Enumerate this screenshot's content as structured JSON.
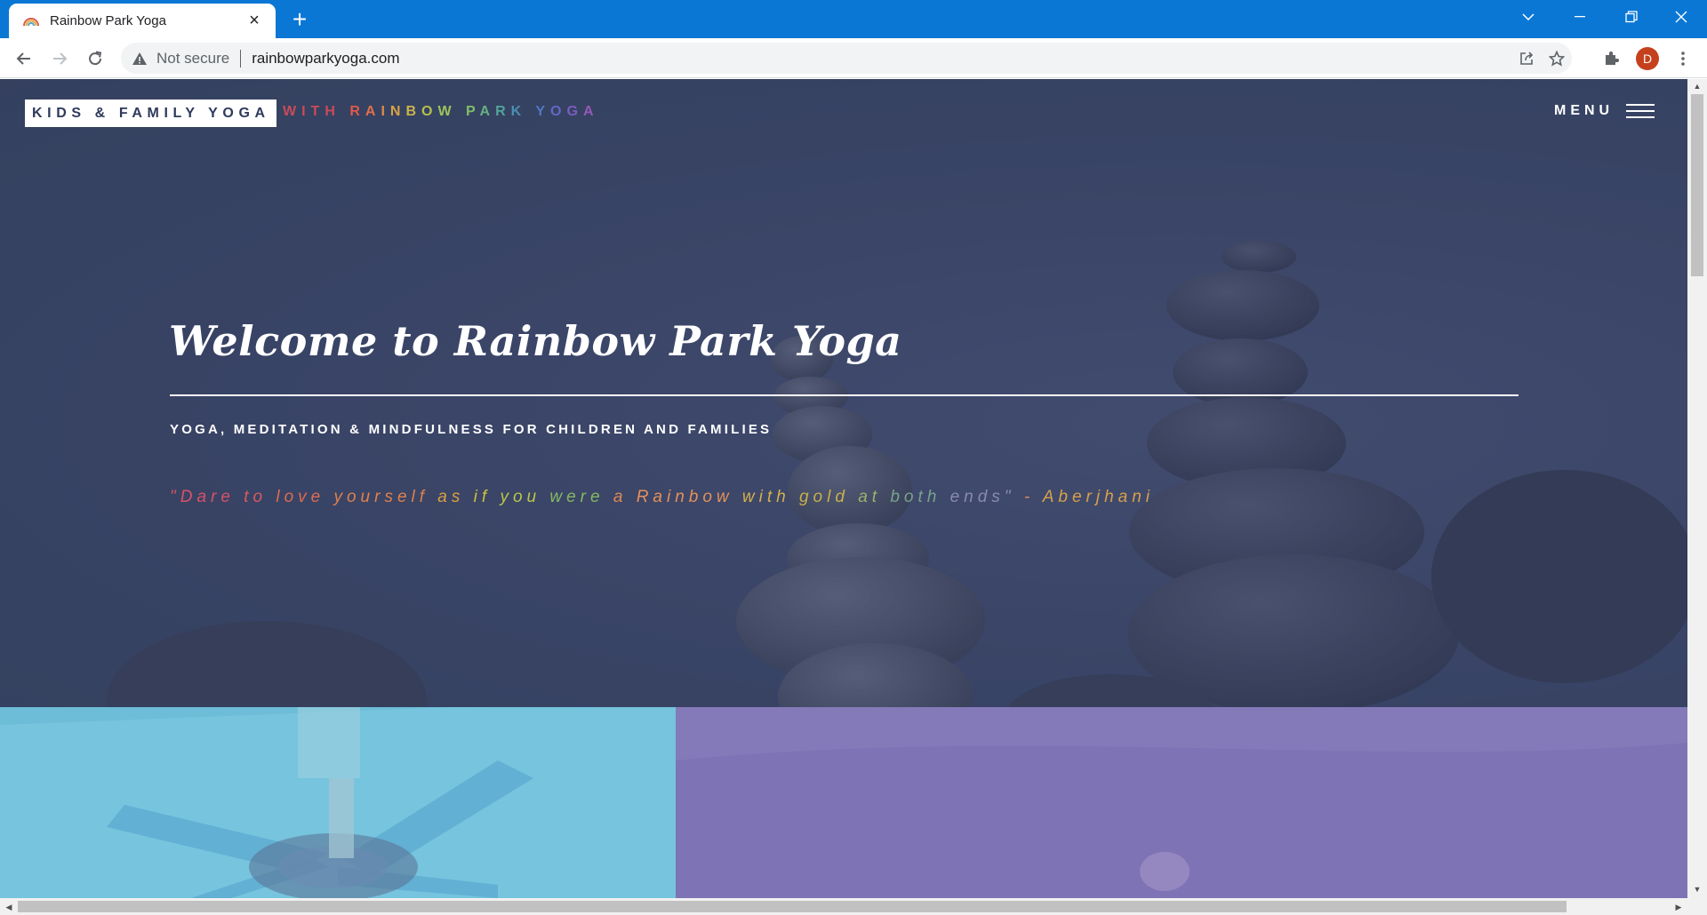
{
  "browser": {
    "tab_title": "Rainbow Park Yoga",
    "tab_close": "×",
    "new_tab": "+",
    "security_label": "Not secure",
    "url": "rainbowparkyoga.com",
    "profile_initial": "D"
  },
  "site": {
    "brand": "KIDS & FAMILY YOGA",
    "brand_sub": {
      "with": "WITH",
      "rainbow_letters": [
        {
          "ch": "R",
          "color": "#e0584a"
        },
        {
          "ch": "A",
          "color": "#e0704a"
        },
        {
          "ch": "I",
          "color": "#e08a48"
        },
        {
          "ch": "N",
          "color": "#d9a244"
        },
        {
          "ch": "B",
          "color": "#c9b44a"
        },
        {
          "ch": "O",
          "color": "#b5bf4c"
        },
        {
          "ch": "W",
          "color": "#9cc35a"
        },
        {
          "ch": " ",
          "color": "#ffffff"
        },
        {
          "ch": "P",
          "color": "#7fbe6a"
        },
        {
          "ch": "A",
          "color": "#64b280"
        },
        {
          "ch": "R",
          "color": "#52a49a"
        },
        {
          "ch": "K",
          "color": "#4b8fb0"
        },
        {
          "ch": " ",
          "color": "#ffffff"
        },
        {
          "ch": "Y",
          "color": "#4f79c0"
        },
        {
          "ch": "O",
          "color": "#6368c2"
        },
        {
          "ch": "G",
          "color": "#7b5cc0"
        },
        {
          "ch": "A",
          "color": "#9558b6"
        }
      ]
    },
    "menu_label": "MENU",
    "welcome": "Welcome to Rainbow Park Yoga",
    "tagline": "YOGA, MEDITATION & MINDFULNESS FOR CHILDREN AND FAMILIES",
    "quote_words": [
      {
        "w": "\"Dare",
        "color": "#d9506a"
      },
      {
        "w": "to",
        "color": "#db5a5e"
      },
      {
        "w": "love",
        "color": "#df6b52"
      },
      {
        "w": "yourself",
        "color": "#e0804a"
      },
      {
        "w": "as",
        "color": "#d9a040"
      },
      {
        "w": "if",
        "color": "#d2c03e"
      },
      {
        "w": "you",
        "color": "#b8c64a"
      },
      {
        "w": "were",
        "color": "#86b860"
      },
      {
        "w": "a",
        "color": "#e08850"
      },
      {
        "w": "Rainbow",
        "color": "#e6905a"
      },
      {
        "w": "with",
        "color": "#d6b04a"
      },
      {
        "w": "gold",
        "color": "#c8b04c"
      },
      {
        "w": "at",
        "color": "#9ab26a"
      },
      {
        "w": "both",
        "color": "#7aa28a"
      },
      {
        "w": "ends\"",
        "color": "#8a8ab0"
      },
      {
        "w": "  -",
        "color": "#e08a5a"
      },
      {
        "w": "Aberjhani",
        "color": "#d8a04a"
      }
    ],
    "colors": {
      "hero_bg": "#3d4a6e",
      "panel_left": "#6dbcd8",
      "panel_right": "#7f74b6",
      "chrome_blue": "#0a77d5"
    }
  }
}
